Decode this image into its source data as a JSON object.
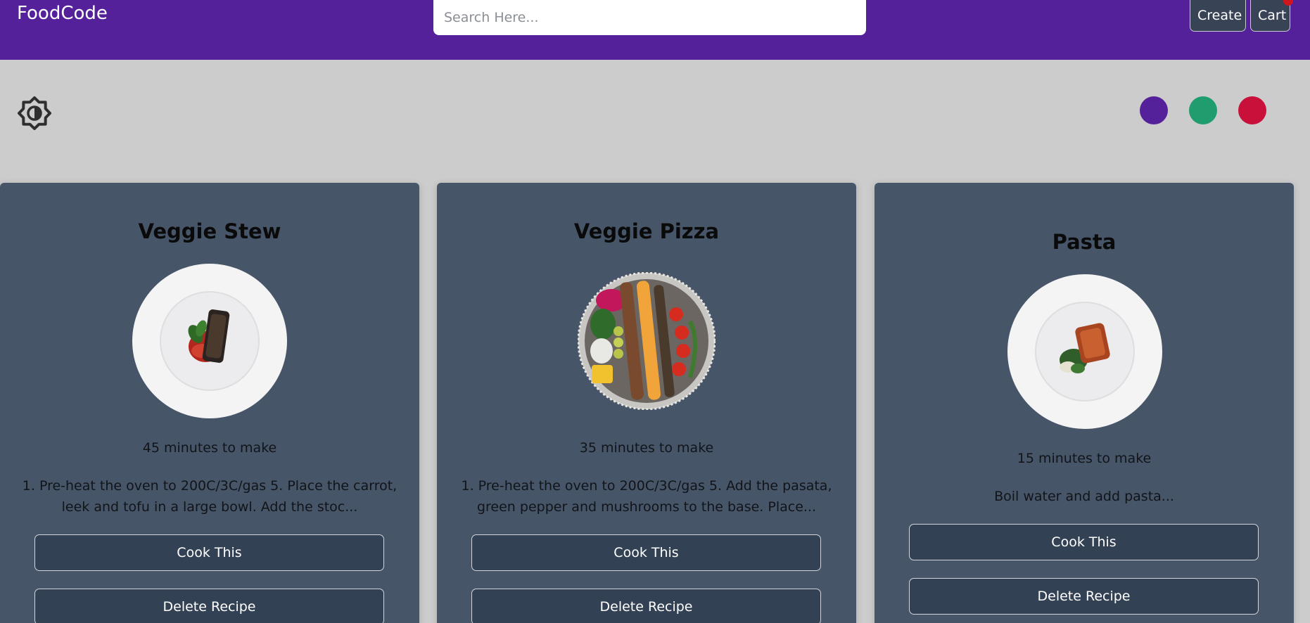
{
  "nav": {
    "brand": "FoodCode",
    "search_placeholder": "Search Here...",
    "create_label": "Create",
    "cart_label": "Cart"
  },
  "theme": {
    "toggle_icon": "brightness-icon",
    "swatches": [
      {
        "name": "purple",
        "color": "#55219b"
      },
      {
        "name": "green",
        "color": "#1f9d6e"
      },
      {
        "name": "red",
        "color": "#c8103a"
      }
    ]
  },
  "colors": {
    "navbar": "#55219b",
    "background": "#cccccc",
    "card": "#475569",
    "button": "#334155",
    "cart_badge": "#d0161d"
  },
  "recipes": [
    {
      "title": "Veggie Stew",
      "image": "salmon-plate-image",
      "time": "45 minutes to make",
      "description": "1. Pre-heat the oven to 200C/3C/gas 5. Place the carrot, leek and tofu in a large bowl. Add the stoc...",
      "cook_label": "Cook This",
      "delete_label": "Delete Recipe"
    },
    {
      "title": "Veggie Pizza",
      "image": "kebab-platter-image",
      "time": "35 minutes to make",
      "description": "1. Pre-heat the oven to 200C/3C/gas 5. Add the pasata, green pepper and mushrooms to the base. Place...",
      "cook_label": "Cook This",
      "delete_label": "Delete Recipe"
    },
    {
      "title": "Pasta",
      "image": "salmon-greens-plate-image",
      "time": "15 minutes to make",
      "description": "Boil water and add pasta...",
      "cook_label": "Cook This",
      "delete_label": "Delete Recipe"
    }
  ]
}
